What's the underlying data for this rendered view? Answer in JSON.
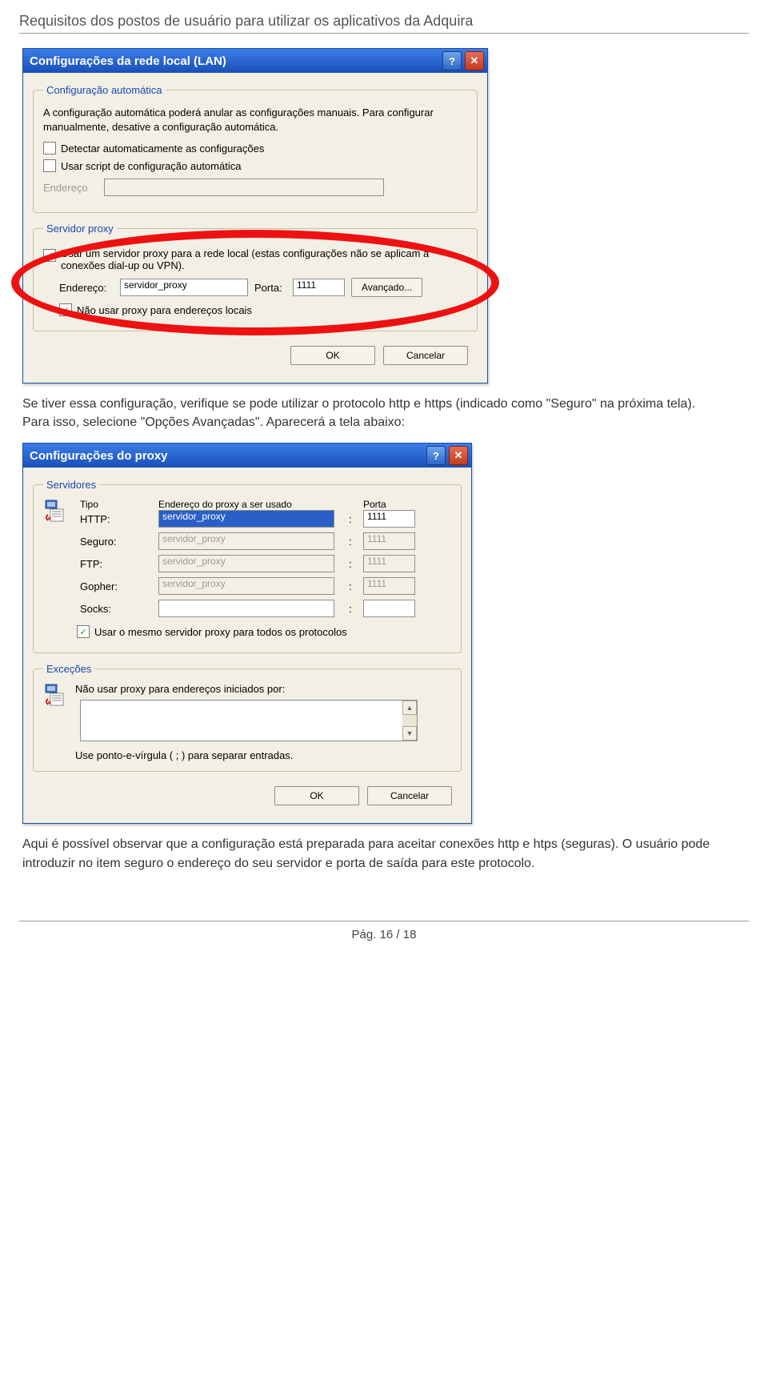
{
  "page_header": "Requisitos dos postos de usuário para utilizar os aplicativos da Adquira",
  "dialog1": {
    "title": "Configurações da rede local (LAN)",
    "group_auto": {
      "legend": "Configuração automática",
      "desc": "A configuração automática poderá anular as configurações manuais. Para configurar manualmente, desative a configuração automática.",
      "chk_detect": "Detectar automaticamente as configurações",
      "chk_script": "Usar script de configuração automática",
      "addr_label": "Endereço"
    },
    "group_proxy": {
      "legend": "Servidor proxy",
      "chk_use": "Usar um servidor proxy para a rede local (estas configurações não se aplicam a conexões dial-up ou VPN).",
      "addr_label": "Endereço:",
      "addr_value": "servidor_proxy",
      "port_label": "Porta:",
      "port_value": "1111",
      "advanced": "Avançado...",
      "chk_bypass": "Não usar proxy para endereços locais"
    },
    "ok": "OK",
    "cancel": "Cancelar"
  },
  "para1": "Se tiver essa configuração, verifique se pode utilizar o protocolo http e https (indicado como \"Seguro\" na próxima tela). Para isso, selecione \"Opções Avançadas\". Aparecerá a tela abaixo:",
  "dialog2": {
    "title": "Configurações do proxy",
    "group_servers": {
      "legend": "Servidores",
      "col_type": "Tipo",
      "col_addr": "Endereço do proxy a ser usado",
      "col_port": "Porta",
      "rows": [
        {
          "type": "HTTP:",
          "addr": "servidor_proxy",
          "port": "1111",
          "enabled": true,
          "selected": true
        },
        {
          "type": "Seguro:",
          "addr": "servidor_proxy",
          "port": "1111",
          "enabled": false
        },
        {
          "type": "FTP:",
          "addr": "servidor_proxy",
          "port": "1111",
          "enabled": false
        },
        {
          "type": "Gopher:",
          "addr": "servidor_proxy",
          "port": "1111",
          "enabled": false
        },
        {
          "type": "Socks:",
          "addr": "",
          "port": "",
          "enabled": true
        }
      ],
      "chk_same": "Usar o mesmo servidor proxy para todos os protocolos"
    },
    "group_excep": {
      "legend": "Exceções",
      "label": "Não usar proxy para endereços iniciados por:",
      "hint": "Use ponto-e-vírgula ( ; ) para separar entradas."
    },
    "ok": "OK",
    "cancel": "Cancelar"
  },
  "para2": "Aqui é possível observar que a configuração está preparada para aceitar conexões http e htps (seguras). O usuário pode introduzir no item seguro o endereço do seu servidor e porta de saída para este protocolo.",
  "footer": "Pág. 16 / 18"
}
